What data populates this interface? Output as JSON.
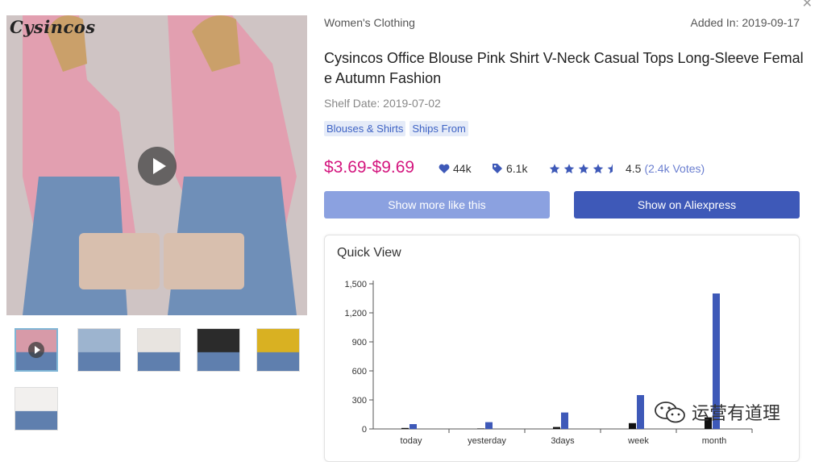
{
  "gallery": {
    "brand": "Cysincos",
    "thumbnails": [
      {
        "color": "#d79aa8",
        "active": true,
        "video": true
      },
      {
        "color": "#9db4cf",
        "active": false,
        "video": false
      },
      {
        "color": "#e8e4e0",
        "active": false,
        "video": false
      },
      {
        "color": "#2b2b2b",
        "active": false,
        "video": false
      },
      {
        "color": "#d9b122",
        "active": false,
        "video": false
      },
      {
        "color": "#f2f0ee",
        "active": false,
        "video": false
      }
    ]
  },
  "product": {
    "category": "Women's Clothing",
    "added": "Added In: 2019-09-17",
    "title": "Cysincos Office Blouse Pink Shirt V-Neck Casual Tops Long-Sleeve Female Autumn Fashion",
    "shelf_date": "Shelf Date: 2019-07-02",
    "tags": [
      "Blouses & Shirts",
      "Ships From"
    ],
    "price": "$3.69-$9.69",
    "likes": "44k",
    "orders": "6.1k",
    "rating": "4.5",
    "votes": "(2.4k Votes)",
    "rating_value": 4.5
  },
  "buttons": {
    "more": "Show more like this",
    "aliexpress": "Show on Aliexpress"
  },
  "quick_view": {
    "title": "Quick View"
  },
  "chart_data": {
    "type": "bar",
    "categories": [
      "today",
      "yesterday",
      "3days",
      "week",
      "month"
    ],
    "series": [
      {
        "values": [
          10,
          5,
          20,
          60,
          120
        ],
        "color": "#111111"
      },
      {
        "values": [
          50,
          70,
          170,
          350,
          1400
        ],
        "color": "#3e59b8"
      }
    ],
    "yticks": [
      "0",
      "300",
      "600",
      "900",
      "1,200",
      "1,500"
    ],
    "ylim": [
      0,
      1500
    ]
  },
  "watermark": "运营有道理",
  "colors": {
    "accent": "#3e59b8",
    "price": "#d4177f",
    "star": "#3e59b8"
  }
}
